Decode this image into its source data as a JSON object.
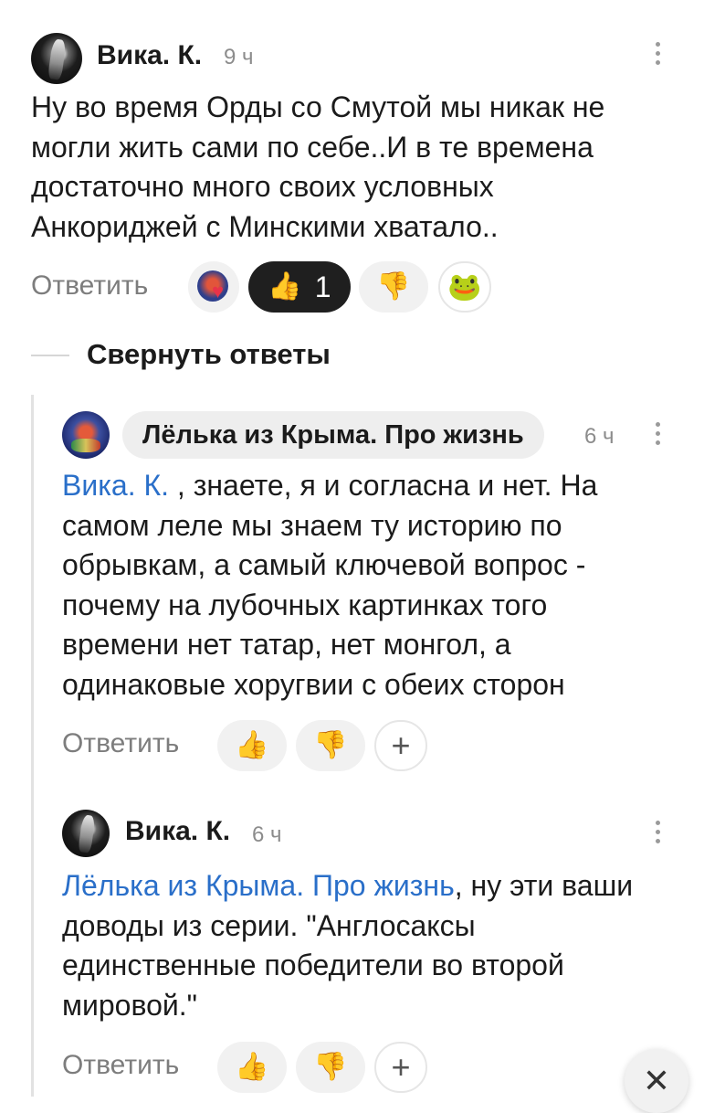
{
  "comment1": {
    "author": "Вика. К.",
    "time": "9 ч",
    "text": "Ну во время Орды со Смутой мы никак не могли жить сами по себе..И в те времена достаточно много своих условных Анкориджей с Минскими хватало..",
    "reply_label": "Ответить",
    "like_count": "1",
    "icons": {
      "like": "thumbs-up-icon",
      "dislike": "thumbs-down-icon",
      "frog": "frog-icon",
      "reactions": "reaction-avatar-heart-icon"
    }
  },
  "collapse": {
    "label": "Свернуть ответы"
  },
  "comment2": {
    "author": "Лёлька из Крыма. Про жизнь",
    "time": "6 ч",
    "mention": "Вика. К.",
    "text": " , знаете, я и согласна и нет. На самом леле мы знаем ту историю по обрывкам, а самый ключевой вопрос - почему на лубочных картинках того времени нет татар, нет монгол, а одинаковые хоругвии с обеих сторон",
    "reply_label": "Ответить",
    "add_reaction": "+"
  },
  "comment3": {
    "author": "Вика. К.",
    "time": "6 ч",
    "mention": "Лёлька из Крыма. Про жизнь",
    "text": ", ну эти ваши доводы из серии. \"Англосаксы единственные победители во второй мировой.\"",
    "reply_label": "Ответить",
    "add_reaction": "+"
  },
  "close": {
    "symbol": "✕"
  }
}
